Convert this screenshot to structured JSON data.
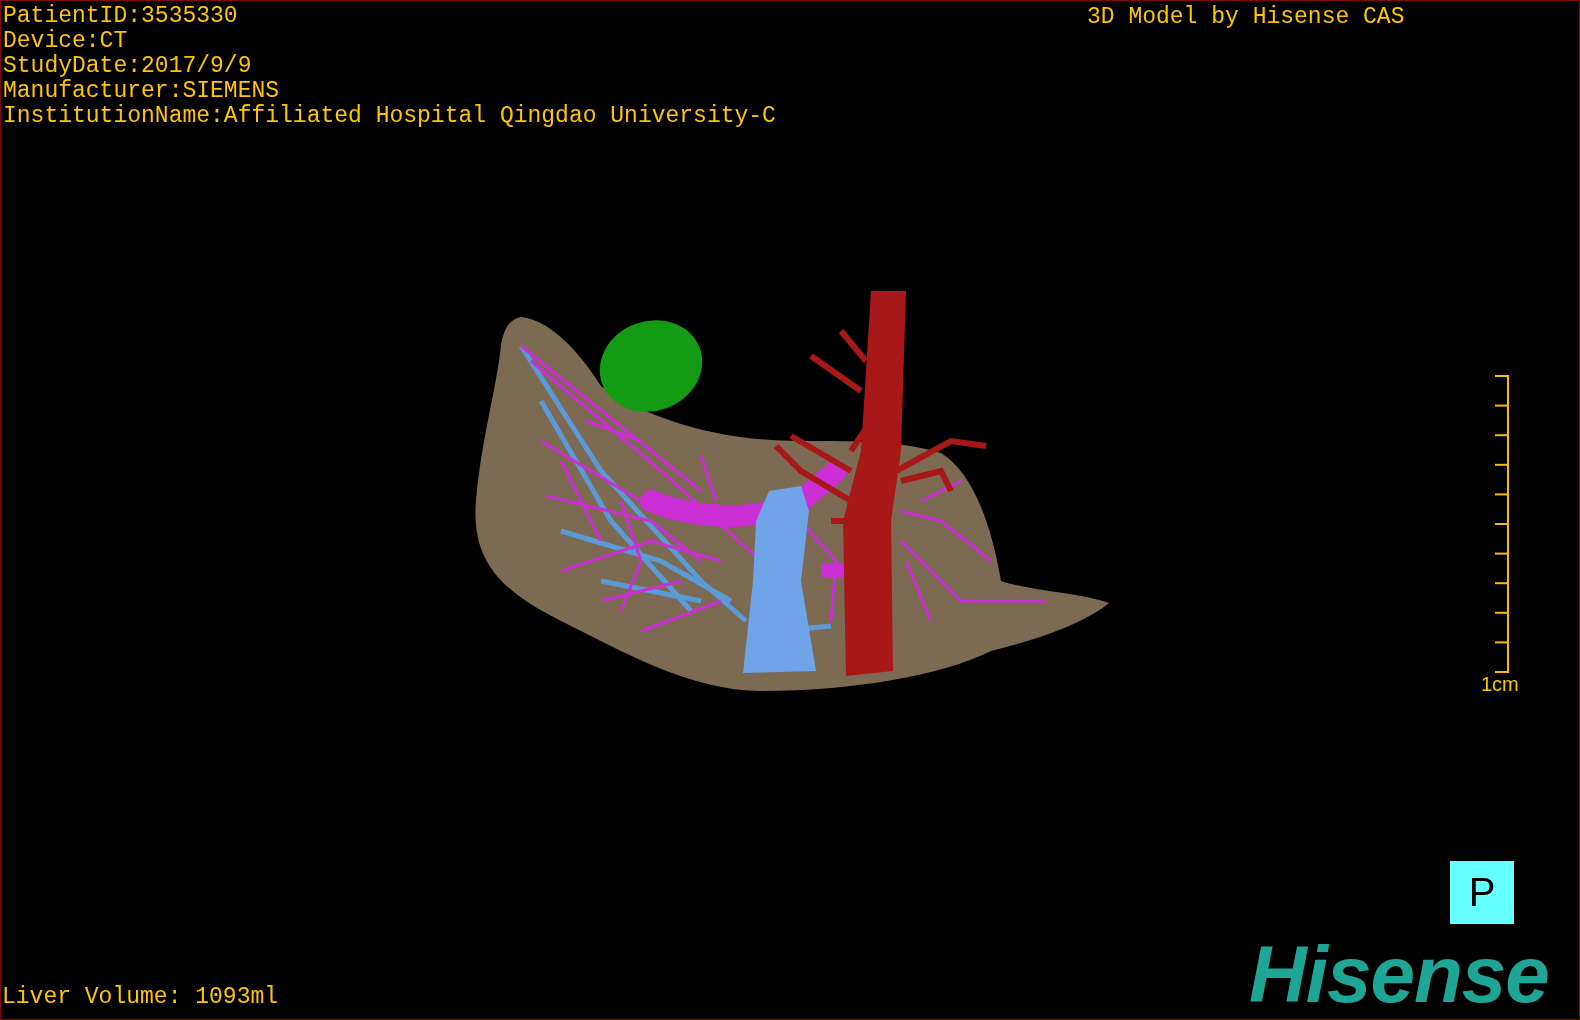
{
  "info_lines": [
    "PatientID:3535330",
    "Device:CT",
    "StudyDate:2017/9/9",
    "Manufacturer:SIEMENS",
    "InstitutionName:Affiliated Hospital Qingdao University-C"
  ],
  "model_credit": "3D Model by Hisense CAS",
  "scale_bar": {
    "label": "1cm"
  },
  "orientation_button": {
    "label": "P"
  },
  "logo": {
    "text": "Hisense"
  },
  "liver_volume": "Liver Volume: 1093ml"
}
